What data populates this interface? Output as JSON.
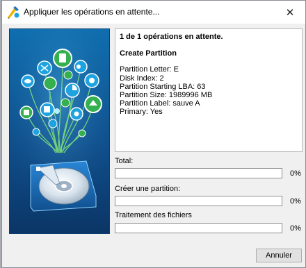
{
  "window": {
    "title": "Appliquer les opérations en attente...",
    "close_glyph": "✕",
    "app_icon": "partition-wizard-icon"
  },
  "details": {
    "header": "1 de 1 opérations en attente.",
    "operation": "Create Partition",
    "lines": [
      "Partition Letter: E",
      "Disk Index: 2",
      "Partition Starting LBA: 63",
      "Partition Size: 1989996 MB",
      "Partition Label: sauve A",
      "Primary: Yes"
    ]
  },
  "progress": {
    "total_label": "Total:",
    "total_value": "0%",
    "total_fraction": 0,
    "create_label": "Créer une partition:",
    "create_value": "0%",
    "create_fraction": 0,
    "files_label": "Traitement des fichiers",
    "files_value": "0%",
    "files_fraction": 0
  },
  "buttons": {
    "cancel": "Annuler"
  },
  "colors": {
    "illustration_bg": "#0f4f8c",
    "progress_fill": "#06b025",
    "disk_blue": "#1a6fc1"
  }
}
